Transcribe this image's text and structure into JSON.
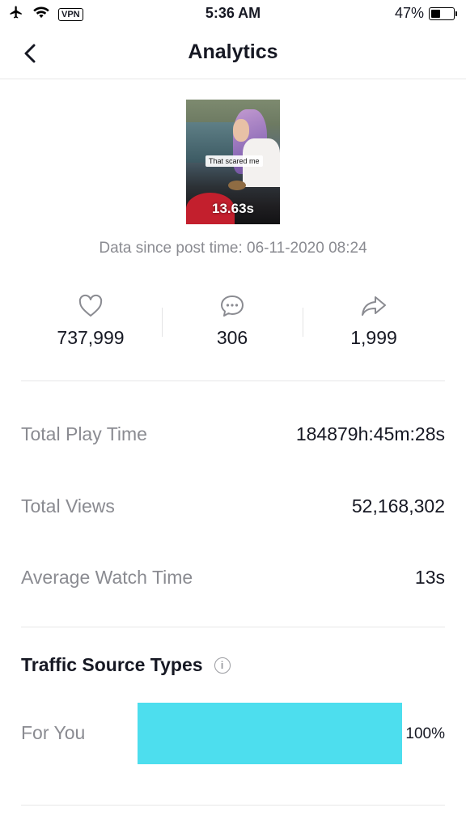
{
  "status_bar": {
    "time": "5:36 AM",
    "vpn_label": "VPN",
    "battery_percent": "47%",
    "battery_level": 0.47
  },
  "header": {
    "title": "Analytics",
    "back_icon": "chevron-left-icon"
  },
  "video": {
    "caption": "That scared me",
    "duration": "13.63s"
  },
  "data_since": "Data since post time: 06-11-2020 08:24",
  "engagement": {
    "likes": "737,999",
    "comments": "306",
    "shares": "1,999",
    "icons": [
      "heart-icon",
      "comment-icon",
      "share-icon"
    ]
  },
  "metrics": [
    {
      "label": "Total Play Time",
      "value": "184879h:45m:28s"
    },
    {
      "label": "Total Views",
      "value": "52,168,302"
    },
    {
      "label": "Average Watch Time",
      "value": "13s"
    }
  ],
  "traffic": {
    "title": "Traffic Source Types",
    "info_icon": "info-icon",
    "sources": [
      {
        "label": "For You",
        "percent_text": "100%",
        "percent": 100
      }
    ],
    "bar_color": "#4ddeee"
  }
}
